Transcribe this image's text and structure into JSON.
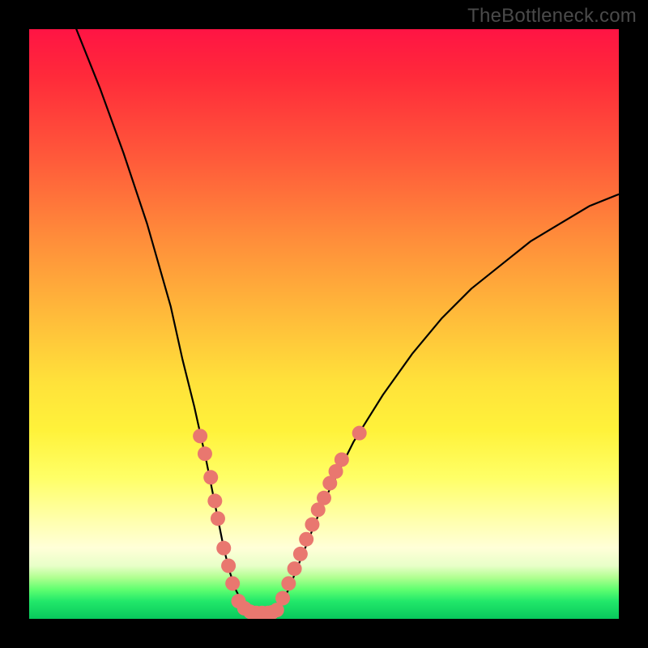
{
  "watermark": "TheBottleneck.com",
  "colors": {
    "curve": "#000000",
    "dot": "#e9776f",
    "gradient_top": "#ff1444",
    "gradient_bottom": "#08c85c"
  },
  "chart_data": {
    "type": "line",
    "title": "",
    "xlabel": "",
    "ylabel": "",
    "xlim": [
      0,
      100
    ],
    "ylim": [
      0,
      100
    ],
    "grid": false,
    "legend": false,
    "series": [
      {
        "name": "bottleneck-curve",
        "x": [
          8,
          12,
          16,
          20,
          24,
          26,
          28,
          30,
          31,
          32,
          33,
          34,
          35,
          36,
          37,
          38,
          39,
          40,
          41,
          42,
          44,
          46,
          50,
          55,
          60,
          65,
          70,
          75,
          80,
          85,
          90,
          95,
          100
        ],
        "y": [
          100,
          90,
          79,
          67,
          53,
          44,
          36,
          27,
          22,
          17,
          12,
          8,
          5,
          3,
          1.5,
          1,
          1,
          1,
          1,
          1.2,
          5,
          10,
          20,
          30,
          38,
          45,
          51,
          56,
          60,
          64,
          67,
          70,
          72
        ]
      }
    ],
    "points": [
      {
        "name": "left-dot-1",
        "x": 29.0,
        "y": 31
      },
      {
        "name": "left-dot-2",
        "x": 29.8,
        "y": 28
      },
      {
        "name": "left-dot-3",
        "x": 30.8,
        "y": 24
      },
      {
        "name": "left-dot-4",
        "x": 31.5,
        "y": 20
      },
      {
        "name": "left-dot-5",
        "x": 32.0,
        "y": 17
      },
      {
        "name": "left-dot-6",
        "x": 33.0,
        "y": 12
      },
      {
        "name": "left-dot-7",
        "x": 33.8,
        "y": 9
      },
      {
        "name": "left-dot-8",
        "x": 34.5,
        "y": 6
      },
      {
        "name": "bottom-dot-1",
        "x": 35.5,
        "y": 3
      },
      {
        "name": "bottom-dot-2",
        "x": 36.5,
        "y": 1.8
      },
      {
        "name": "bottom-dot-3",
        "x": 37.5,
        "y": 1.2
      },
      {
        "name": "bottom-dot-4",
        "x": 38.5,
        "y": 1.0
      },
      {
        "name": "bottom-dot-5",
        "x": 39.5,
        "y": 1.0
      },
      {
        "name": "bottom-dot-6",
        "x": 40.5,
        "y": 1.0
      },
      {
        "name": "bottom-dot-7",
        "x": 41.2,
        "y": 1.1
      },
      {
        "name": "bottom-dot-8",
        "x": 42.0,
        "y": 1.5
      },
      {
        "name": "right-dot-1",
        "x": 43.0,
        "y": 3.5
      },
      {
        "name": "right-dot-2",
        "x": 44.0,
        "y": 6
      },
      {
        "name": "right-dot-3",
        "x": 45.0,
        "y": 8.5
      },
      {
        "name": "right-dot-4",
        "x": 46.0,
        "y": 11
      },
      {
        "name": "right-dot-5",
        "x": 47.0,
        "y": 13.5
      },
      {
        "name": "right-dot-6",
        "x": 48.0,
        "y": 16
      },
      {
        "name": "right-dot-7",
        "x": 49.0,
        "y": 18.5
      },
      {
        "name": "right-dot-8",
        "x": 50.0,
        "y": 20.5
      },
      {
        "name": "right-dot-9",
        "x": 51.0,
        "y": 23
      },
      {
        "name": "right-dot-10",
        "x": 52.0,
        "y": 25
      },
      {
        "name": "right-dot-11",
        "x": 53.0,
        "y": 27
      },
      {
        "name": "right-dot-outlier",
        "x": 56.0,
        "y": 31.5
      }
    ]
  }
}
